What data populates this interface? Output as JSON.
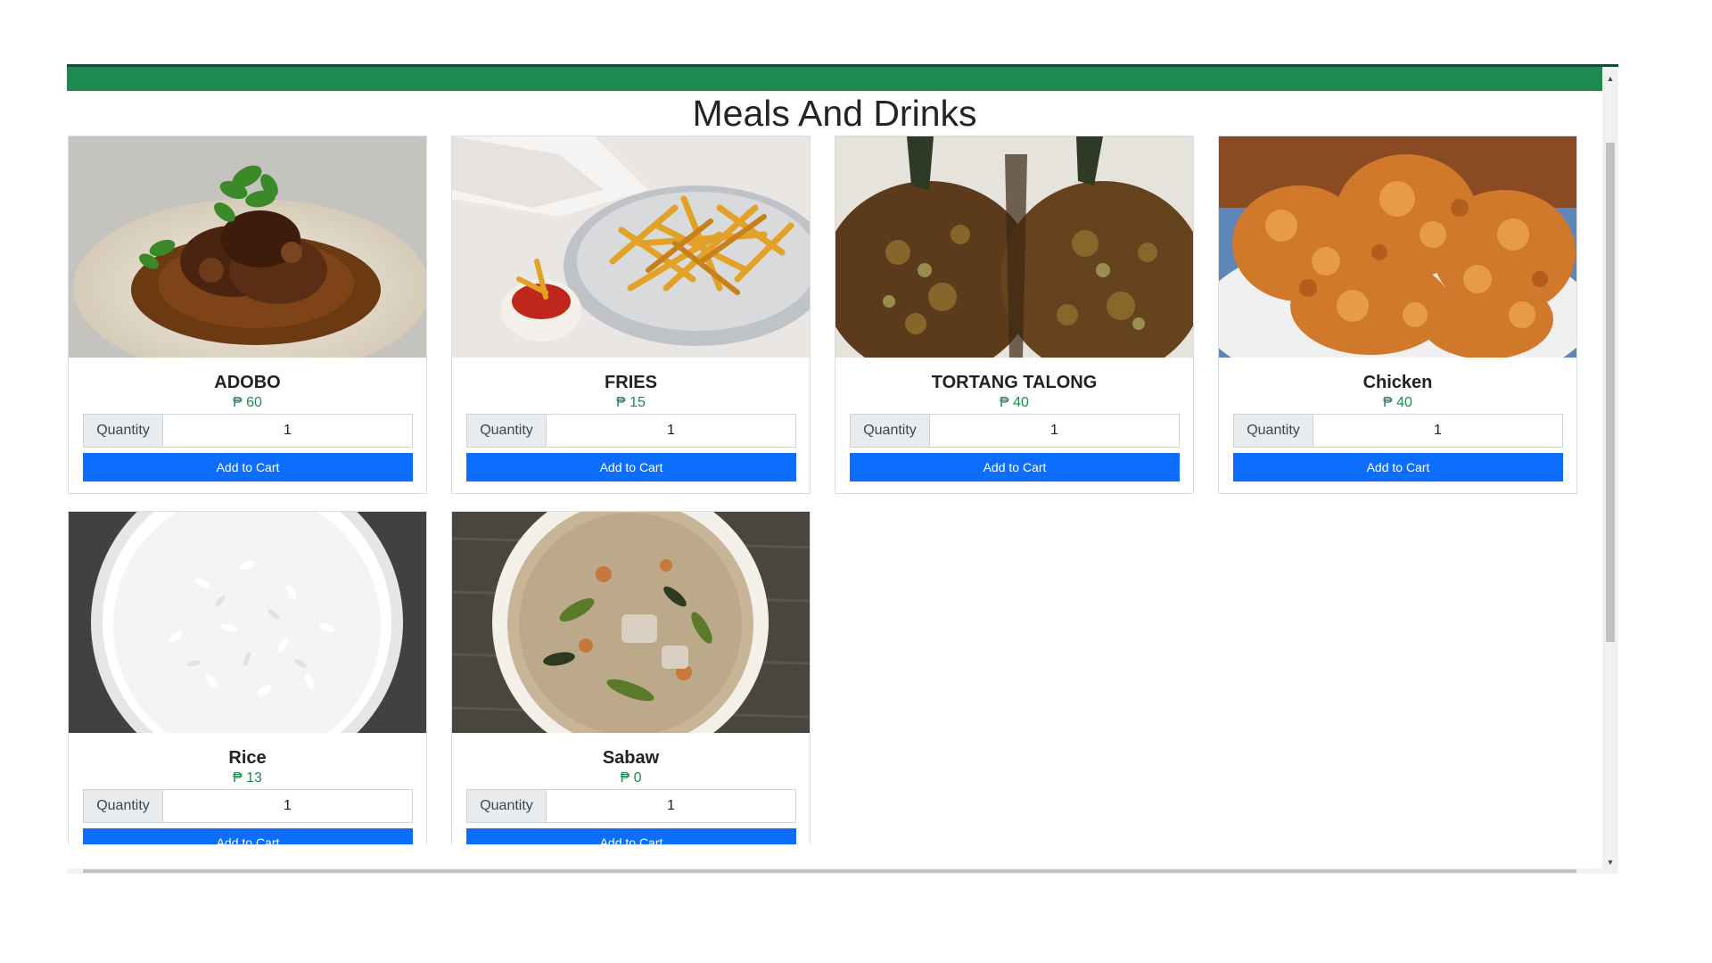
{
  "page": {
    "title": "Meals And Drinks"
  },
  "colors": {
    "header": "#1e8a4f",
    "price": "#1e8a4f",
    "button": "#0d6efd"
  },
  "products": [
    {
      "name": "ADOBO",
      "price": "₱ 60",
      "quantity_label": "Quantity",
      "quantity": "1",
      "button_label": "Add to Cart",
      "image": "adobo-dish"
    },
    {
      "name": "FRIES",
      "price": "₱ 15",
      "quantity_label": "Quantity",
      "quantity": "1",
      "button_label": "Add to Cart",
      "image": "french-fries"
    },
    {
      "name": "TORTANG TALONG",
      "price": "₱ 40",
      "quantity_label": "Quantity",
      "quantity": "1",
      "button_label": "Add to Cart",
      "image": "eggplant-omelette"
    },
    {
      "name": "Chicken",
      "price": "₱ 40",
      "quantity_label": "Quantity",
      "quantity": "1",
      "button_label": "Add to Cart",
      "image": "fried-chicken"
    },
    {
      "name": "Rice",
      "price": "₱ 13",
      "quantity_label": "Quantity",
      "quantity": "1",
      "button_label": "Add to Cart",
      "image": "rice-bowl"
    },
    {
      "name": "Sabaw",
      "price": "₱ 0",
      "quantity_label": "Quantity",
      "quantity": "1",
      "button_label": "Add to Cart",
      "image": "soup-bowl"
    }
  ]
}
